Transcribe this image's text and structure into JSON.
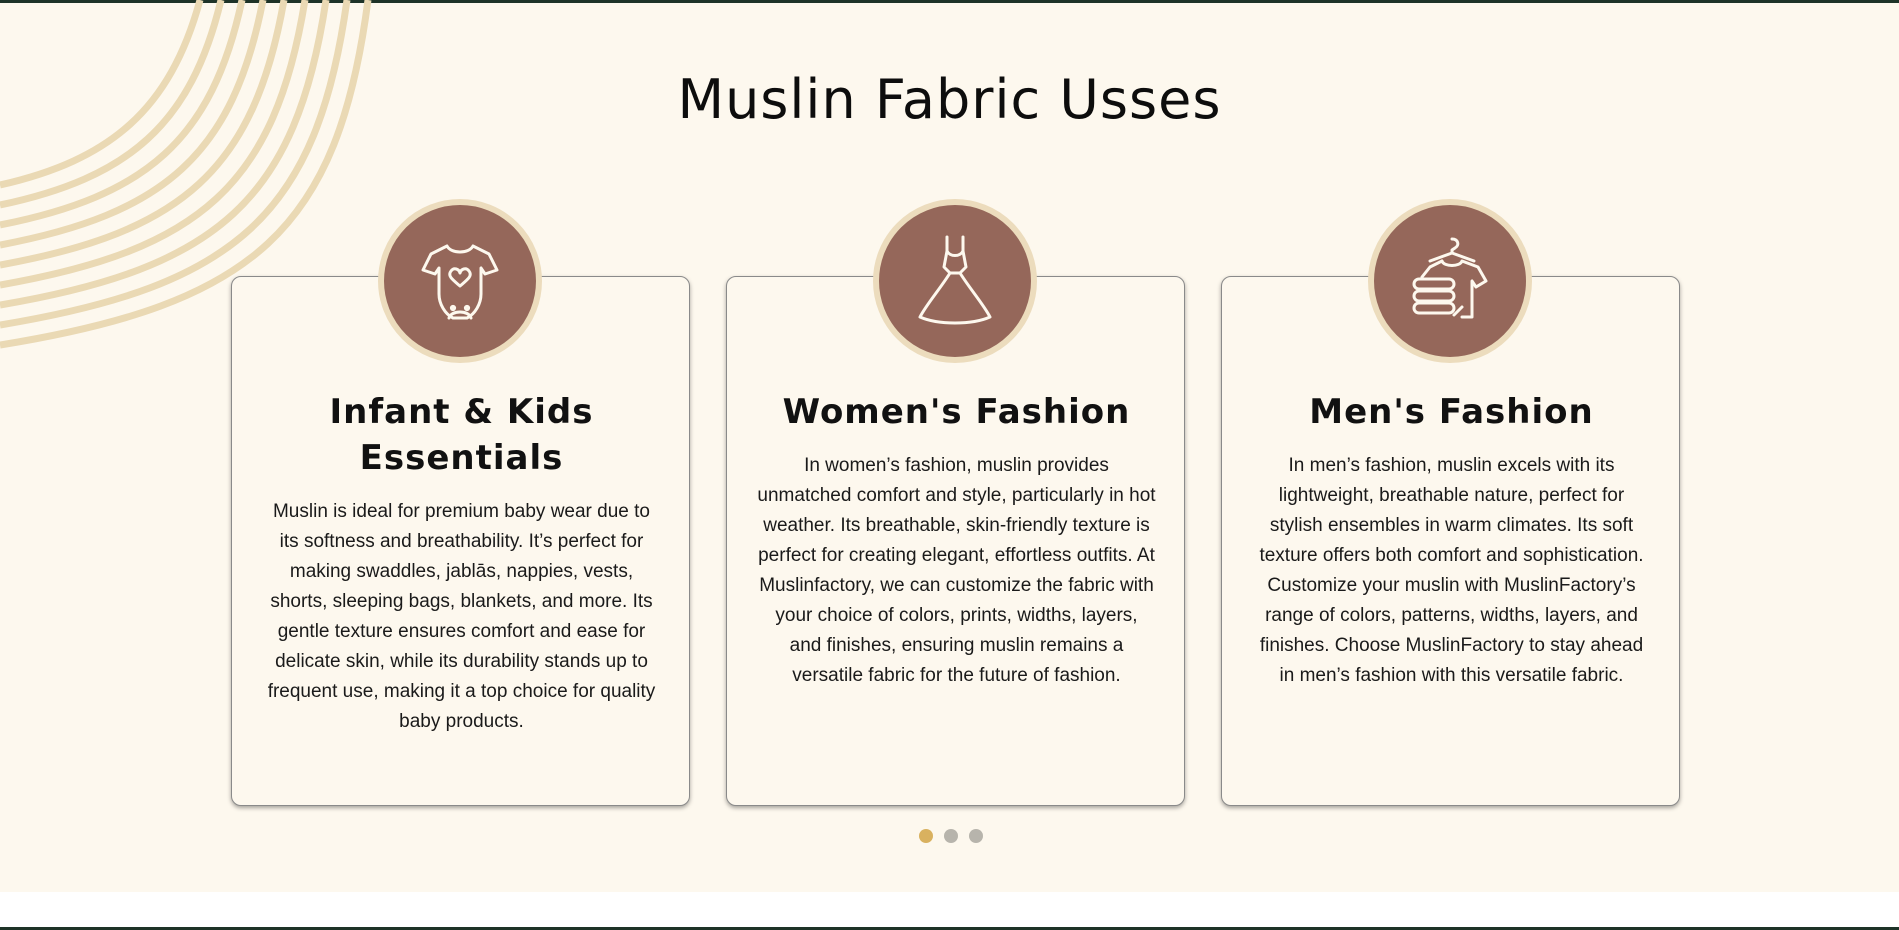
{
  "section": {
    "title": "Muslin Fabric Usses"
  },
  "cards": [
    {
      "icon": "baby-onesie-icon",
      "title": "Infant & Kids Essentials",
      "text": "Muslin is ideal for premium baby wear due to its softness and breathability. It’s perfect for making swaddles, jablās, nappies, vests, shorts, sleeping bags, blankets, and more. Its gentle texture ensures comfort and ease for delicate skin, while its durability stands up to frequent use, making it a top choice for quality baby products."
    },
    {
      "icon": "dress-icon",
      "title": "Women's Fashion",
      "text": "In women’s fashion, muslin provides unmatched comfort and style, particularly in hot weather. Its breathable, skin-friendly texture is perfect for creating elegant, effortless outfits. At Muslinfactory, we can customize the fabric with your choice of colors, prints, widths, layers, and finishes, ensuring muslin remains a versatile fabric for the future of fashion."
    },
    {
      "icon": "shirt-stack-icon",
      "title": "Men's Fashion",
      "text": "In men’s fashion, muslin excels with its lightweight, breathable nature, perfect for stylish ensembles in warm climates. Its soft texture offers both comfort and sophistication. Customize your muslin with MuslinFactory’s range of colors, patterns, widths, layers, and finishes. Choose MuslinFactory to stay ahead in men’s fashion with this versatile fabric."
    }
  ],
  "carousel": {
    "pages": 3,
    "active_index": 0
  },
  "colors": {
    "background": "#fdf8ee",
    "icon_circle": "#95675a",
    "icon_ring": "#ecdcbd",
    "dot_active": "#d9b15f",
    "dot_inactive": "#b7b4ac",
    "decor_lines": "#ead9b4",
    "border_dark": "#1e3328"
  }
}
